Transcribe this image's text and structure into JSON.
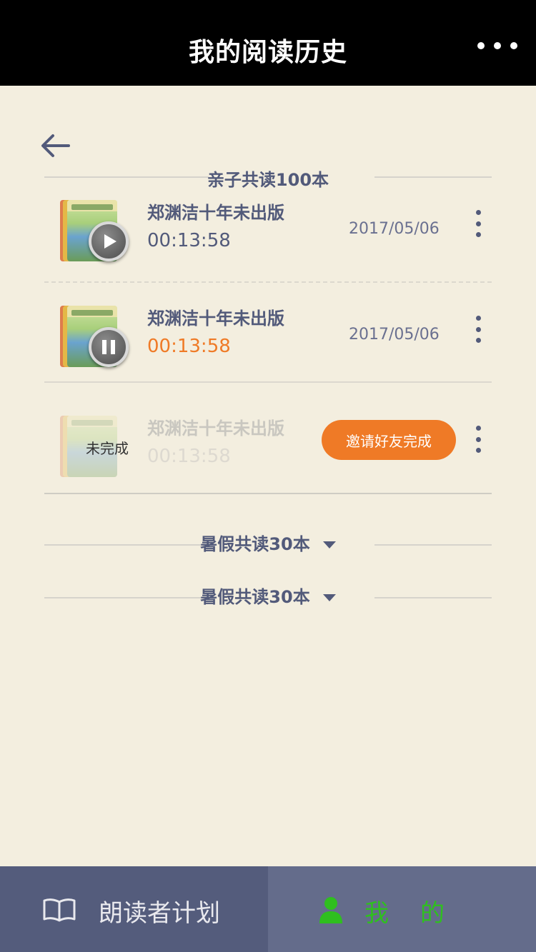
{
  "header": {
    "title": "我的阅读历史"
  },
  "sections": [
    {
      "label": "亲子共读100本"
    },
    {
      "label": "暑假共读30本"
    },
    {
      "label": "暑假共读30本"
    }
  ],
  "items": [
    {
      "title": "郑渊洁十年未出版",
      "time": "00:13:58",
      "date": "2017/05/06",
      "state": "play"
    },
    {
      "title": "郑渊洁十年未出版",
      "time": "00:13:58",
      "date": "2017/05/06",
      "state": "pause"
    },
    {
      "title": "郑渊洁十年未出版",
      "time": "00:13:58",
      "status": "未完成",
      "action": "邀请好友完成"
    }
  ],
  "tabbar": {
    "left": {
      "label": "朗读者计划",
      "icon": "book-icon"
    },
    "right": {
      "label": "我的",
      "icon": "user-icon"
    }
  },
  "colors": {
    "accent": "#ef7a26",
    "active_tab": "#2fbf1f",
    "text": "#525a7a",
    "bg": "#f3eedf"
  }
}
